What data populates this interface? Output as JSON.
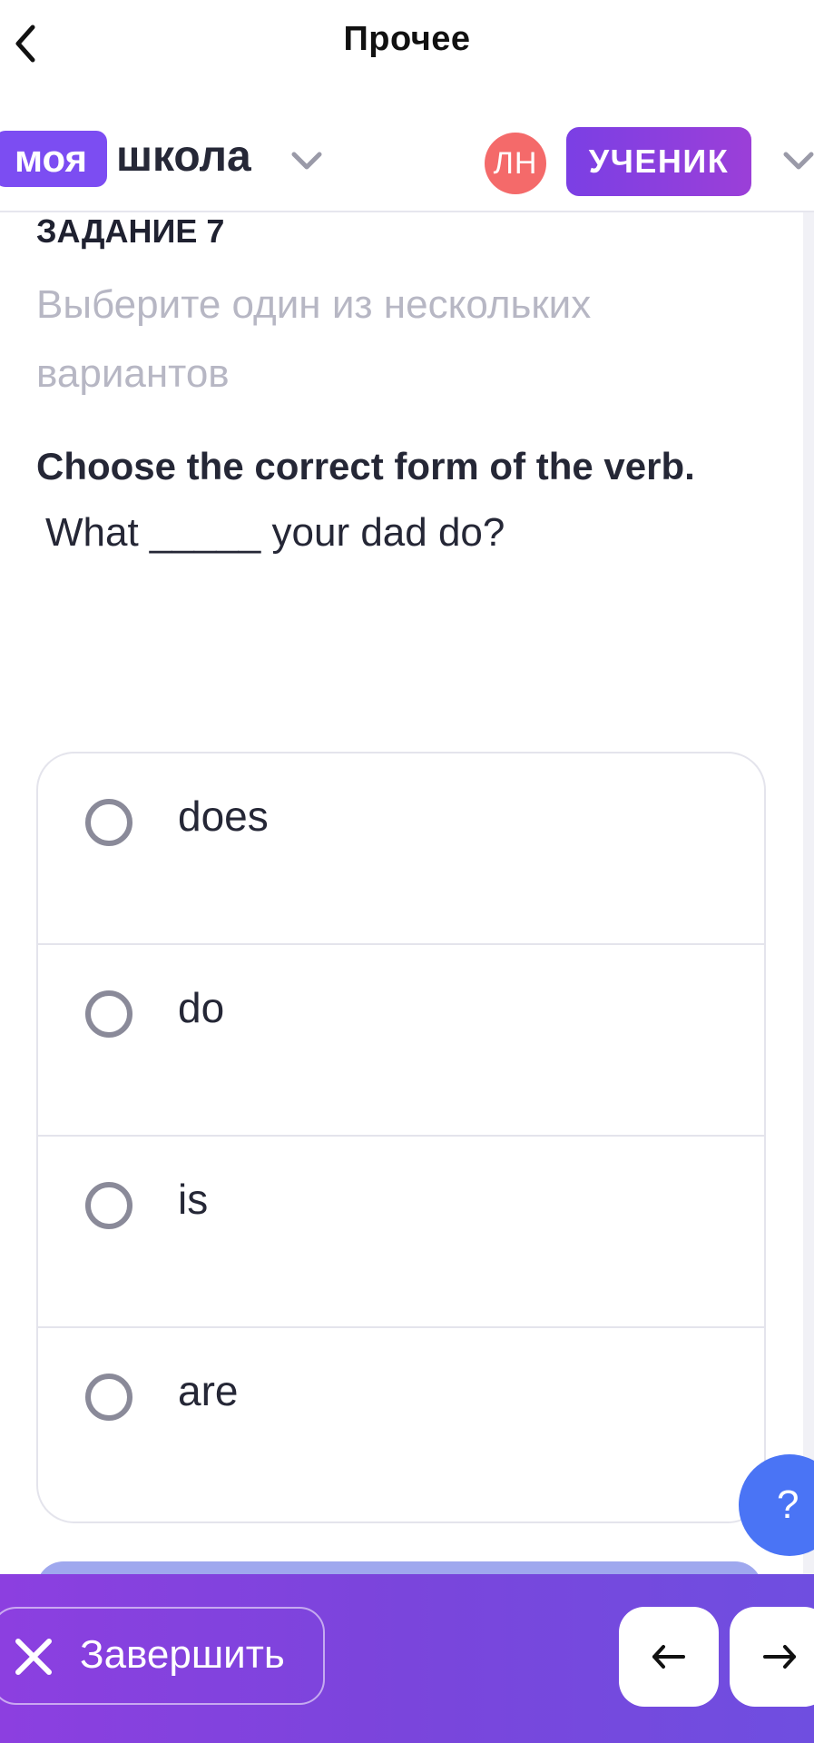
{
  "topbar": {
    "title": "Прочее",
    "back_icon": "chevron-left-icon"
  },
  "header": {
    "logo_badge": "моя",
    "logo_text": "школа",
    "avatar_initials": "ЛН",
    "role": "УЧЕНИК",
    "colors": {
      "logo_badge": "#7c4df2",
      "avatar": "#f46a6a",
      "role_badge": "#8a3fe0"
    }
  },
  "task": {
    "label": "ЗАДАНИЕ 7",
    "instruction": "Выберите один из нескольких вариантов",
    "question_title": "Choose the correct form of the verb.",
    "question_text": "What _____ your dad do?"
  },
  "options": [
    {
      "label": "does",
      "selected": false
    },
    {
      "label": "do",
      "selected": false
    },
    {
      "label": "is",
      "selected": false
    },
    {
      "label": "are",
      "selected": false
    }
  ],
  "help": {
    "label": "?",
    "color": "#4a74f5"
  },
  "bottom_bar": {
    "finish_label": "Завершить",
    "finish_icon": "close-icon",
    "prev_icon": "arrow-left-icon",
    "next_icon": "arrow-right-icon"
  }
}
